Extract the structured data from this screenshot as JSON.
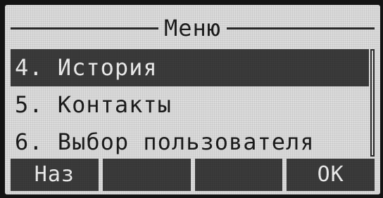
{
  "header": {
    "title": "Меню"
  },
  "menu": {
    "items": [
      {
        "label": "4. История",
        "selected": true
      },
      {
        "label": "5. Контакты",
        "selected": false
      },
      {
        "label": "6. Выбор пользователя",
        "selected": false
      }
    ]
  },
  "softkeys": {
    "key1": "Наз",
    "key2": "",
    "key3": "",
    "key4": "ОК"
  },
  "colors": {
    "screen_background": "#dcdcdc",
    "highlight": "#3b3b3b",
    "text": "#1c1c1c",
    "highlight_text": "#efefef"
  }
}
